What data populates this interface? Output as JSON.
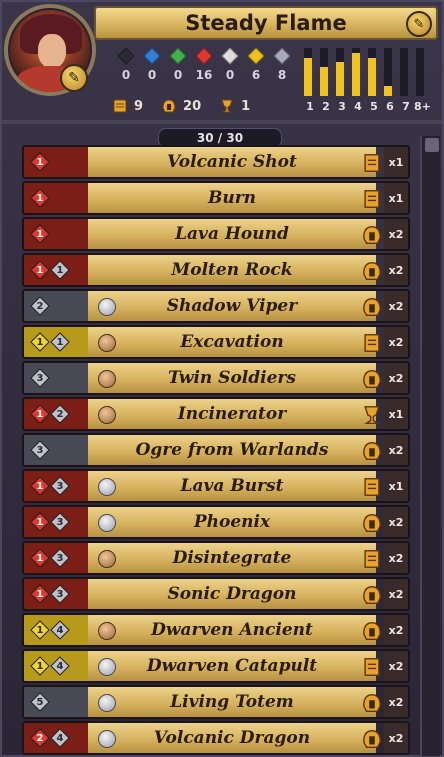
{
  "deck": {
    "title": "Steady Flame",
    "counter": "30 / 30"
  },
  "gems": [
    {
      "color": "#2b2b33",
      "value": "0"
    },
    {
      "color": "#2f7fdb",
      "value": "0"
    },
    {
      "color": "#3fb24a",
      "value": "0"
    },
    {
      "color": "#e0382f",
      "value": "16"
    },
    {
      "color": "#dedede",
      "value": "0"
    },
    {
      "color": "#f0c21c",
      "value": "6"
    },
    {
      "color": "#a8a8b8",
      "value": "8"
    }
  ],
  "counts": {
    "spells": "9",
    "creatures": "20",
    "artifacts": "1"
  },
  "mana_curve": {
    "labels": [
      "1",
      "2",
      "3",
      "4",
      "5",
      "6",
      "7",
      "8+"
    ],
    "values": [
      0.8,
      0.6,
      0.7,
      0.9,
      0.8,
      0.2,
      0.0,
      0.0
    ]
  },
  "cards": [
    {
      "name": "Volcanic Shot",
      "cost": [
        {
          "type": "red",
          "num": "1"
        }
      ],
      "badge": "",
      "type": "scroll",
      "qty": "x1",
      "left": "red"
    },
    {
      "name": "Burn",
      "cost": [
        {
          "type": "red",
          "num": "1"
        }
      ],
      "badge": "",
      "type": "scroll",
      "qty": "x1",
      "left": "red"
    },
    {
      "name": "Lava Hound",
      "cost": [
        {
          "type": "red",
          "num": "1"
        }
      ],
      "badge": "",
      "type": "helmet",
      "qty": "x2",
      "left": "red"
    },
    {
      "name": "Molten Rock",
      "cost": [
        {
          "type": "red",
          "num": "1"
        },
        {
          "type": "gray",
          "num": "1"
        }
      ],
      "badge": "",
      "type": "helmet",
      "qty": "x2",
      "left": "red"
    },
    {
      "name": "Shadow Viper",
      "cost": [
        {
          "type": "gray",
          "num": "2"
        }
      ],
      "badge": "silver",
      "type": "helmet",
      "qty": "x2",
      "left": "gray"
    },
    {
      "name": "Excavation",
      "cost": [
        {
          "type": "yellow",
          "num": "1"
        },
        {
          "type": "gray",
          "num": "1"
        }
      ],
      "badge": "bronze",
      "type": "scroll",
      "qty": "x2",
      "left": "yellow"
    },
    {
      "name": "Twin Soldiers",
      "cost": [
        {
          "type": "gray",
          "num": "3"
        }
      ],
      "badge": "bronze",
      "type": "helmet",
      "qty": "x2",
      "left": "gray"
    },
    {
      "name": "Incinerator",
      "cost": [
        {
          "type": "red",
          "num": "1"
        },
        {
          "type": "gray",
          "num": "2"
        }
      ],
      "badge": "bronze",
      "type": "cup",
      "qty": "x1",
      "left": "red"
    },
    {
      "name": "Ogre from Warlands",
      "cost": [
        {
          "type": "gray",
          "num": "3"
        }
      ],
      "badge": "",
      "type": "helmet",
      "qty": "x2",
      "left": "gray"
    },
    {
      "name": "Lava Burst",
      "cost": [
        {
          "type": "red",
          "num": "1"
        },
        {
          "type": "gray",
          "num": "3"
        }
      ],
      "badge": "silver",
      "type": "scroll",
      "qty": "x1",
      "left": "red"
    },
    {
      "name": "Phoenix",
      "cost": [
        {
          "type": "red",
          "num": "1"
        },
        {
          "type": "gray",
          "num": "3"
        }
      ],
      "badge": "silver",
      "type": "helmet",
      "qty": "x2",
      "left": "red"
    },
    {
      "name": "Disintegrate",
      "cost": [
        {
          "type": "red",
          "num": "1"
        },
        {
          "type": "gray",
          "num": "3"
        }
      ],
      "badge": "bronze",
      "type": "scroll",
      "qty": "x2",
      "left": "red"
    },
    {
      "name": "Sonic Dragon",
      "cost": [
        {
          "type": "red",
          "num": "1"
        },
        {
          "type": "gray",
          "num": "3"
        }
      ],
      "badge": "",
      "type": "helmet",
      "qty": "x2",
      "left": "red"
    },
    {
      "name": "Dwarven Ancient",
      "cost": [
        {
          "type": "yellow",
          "num": "1"
        },
        {
          "type": "gray",
          "num": "4"
        }
      ],
      "badge": "bronze",
      "type": "helmet",
      "qty": "x2",
      "left": "yellow"
    },
    {
      "name": "Dwarven Catapult",
      "cost": [
        {
          "type": "yellow",
          "num": "1"
        },
        {
          "type": "gray",
          "num": "4"
        }
      ],
      "badge": "silver",
      "type": "scroll",
      "qty": "x2",
      "left": "yellow"
    },
    {
      "name": "Living Totem",
      "cost": [
        {
          "type": "gray",
          "num": "5"
        }
      ],
      "badge": "silver",
      "type": "helmet",
      "qty": "x2",
      "left": "gray"
    },
    {
      "name": "Volcanic Dragon",
      "cost": [
        {
          "type": "red",
          "num": "2"
        },
        {
          "type": "gray",
          "num": "4"
        }
      ],
      "badge": "silver",
      "type": "helmet",
      "qty": "x2",
      "left": "red"
    }
  ]
}
